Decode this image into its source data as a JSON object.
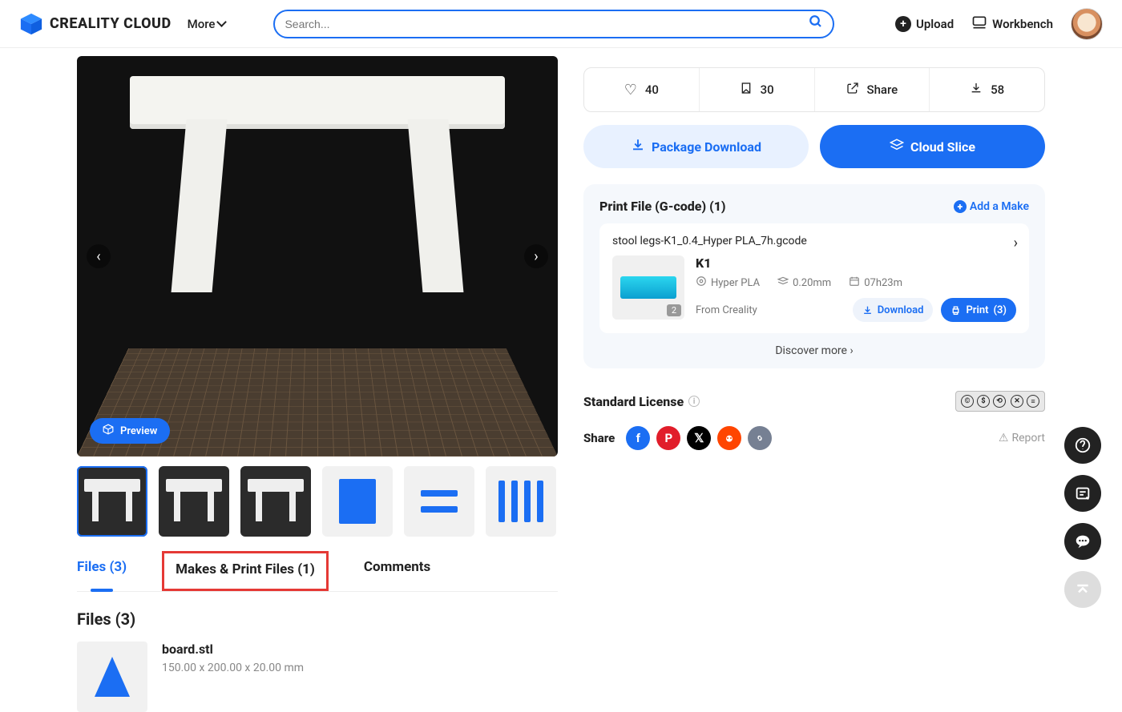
{
  "header": {
    "brand": "CREALITY CLOUD",
    "more_label": "More",
    "search_placeholder": "Search...",
    "upload_label": "Upload",
    "workbench_label": "Workbench"
  },
  "gallery": {
    "preview_label": "Preview"
  },
  "stats": {
    "like_count": "40",
    "book_count": "30",
    "share_label": "Share",
    "download_count": "58"
  },
  "buttons": {
    "package_download": "Package Download",
    "cloud_slice": "Cloud Slice"
  },
  "panel": {
    "title": "Print File (G-code) (1)",
    "add_make": "Add a Make",
    "gcode_name": "stool legs-K1_0.4_Hyper PLA_7h.gcode",
    "printer": "K1",
    "thumb_count": "2",
    "material": "Hyper PLA",
    "layer": "0.20mm",
    "duration": "07h23m",
    "from": "From Creality",
    "download_label": "Download",
    "print_label": "Print",
    "print_count": "(3)",
    "discover": "Discover more"
  },
  "license": {
    "label": "Standard License"
  },
  "share_section": {
    "label": "Share",
    "report": "Report"
  },
  "tabs": {
    "files": "Files (3)",
    "makes": "Makes & Print Files (1)",
    "comments": "Comments"
  },
  "files_list": {
    "heading": "Files (3)",
    "items": [
      {
        "name": "board.stl",
        "dims": "150.00 x 200.00 x 20.00 mm"
      }
    ]
  }
}
